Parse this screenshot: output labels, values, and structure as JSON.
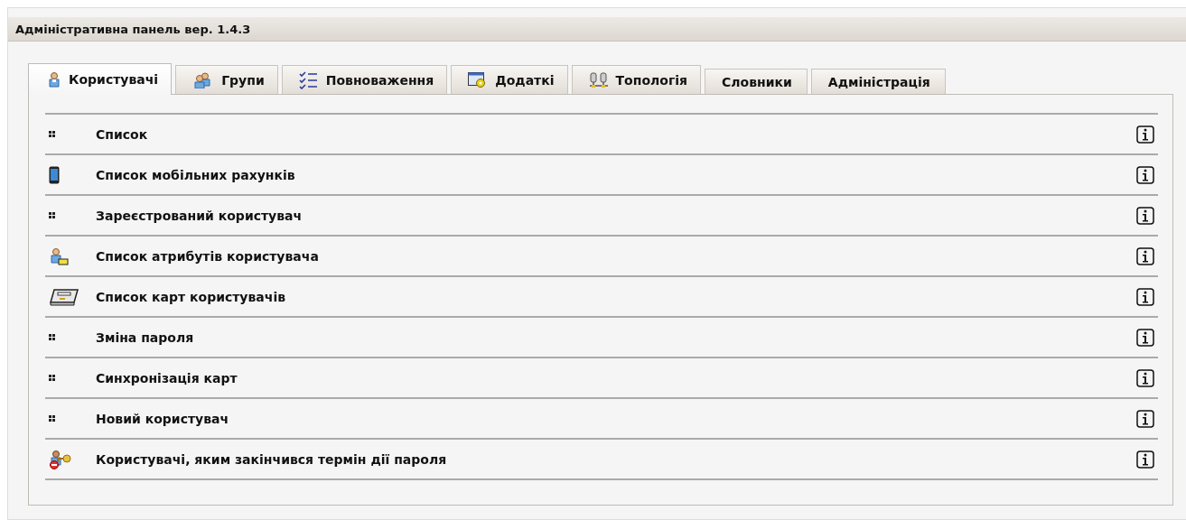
{
  "window": {
    "title": "Адміністративна панель вер. 1.4.3"
  },
  "tabs": [
    {
      "label": "Користувачі",
      "selected": true
    },
    {
      "label": "Групи",
      "selected": false
    },
    {
      "label": "Повноваження",
      "selected": false
    },
    {
      "label": "Додаткі",
      "selected": false
    },
    {
      "label": "Топологія",
      "selected": false
    },
    {
      "label": "Словники",
      "selected": false
    },
    {
      "label": "Адміністрація",
      "selected": false
    }
  ],
  "items": [
    {
      "label": "Список"
    },
    {
      "label": "Список мобільних рахунків"
    },
    {
      "label": "Зареєстрований користувач"
    },
    {
      "label": "Список атрибутів користувача"
    },
    {
      "label": "Список карт користувачів"
    },
    {
      "label": "Зміна пароля"
    },
    {
      "label": "Синхронізація карт"
    },
    {
      "label": "Новий користувач"
    },
    {
      "label": "Користувачі, яким закінчився термін дії пароля"
    }
  ]
}
